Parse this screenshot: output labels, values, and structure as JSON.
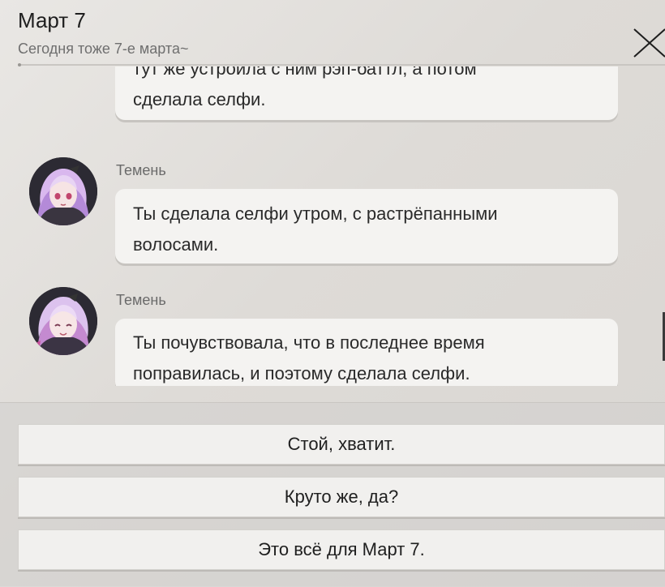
{
  "header": {
    "title": "Март 7",
    "subtitle": "Сегодня тоже 7-е марта~"
  },
  "messages": [
    {
      "sender": "",
      "lines": [
        "тут же устроила с ним рэп-баттл, а потом",
        "сделала селфи."
      ]
    },
    {
      "sender": "Темень",
      "lines": [
        "Ты сделала селфи утром, с растрёпанными",
        "волосами."
      ]
    },
    {
      "sender": "Темень",
      "lines": [
        "Ты почувствовала, что в последнее время",
        "поправилась, и поэтому сделала селфи."
      ]
    }
  ],
  "options": [
    {
      "label": "Стой, хватит."
    },
    {
      "label": "Круто же, да?"
    },
    {
      "label": "Это всё для Март 7."
    }
  ],
  "icons": {
    "close": "close-icon",
    "avatar": "avatar"
  },
  "colors": {
    "background": "#e4e2df",
    "bubble": "#f4f3f1",
    "option": "#f1f0ee",
    "text": "#222222",
    "muted": "#6f6f6f"
  }
}
